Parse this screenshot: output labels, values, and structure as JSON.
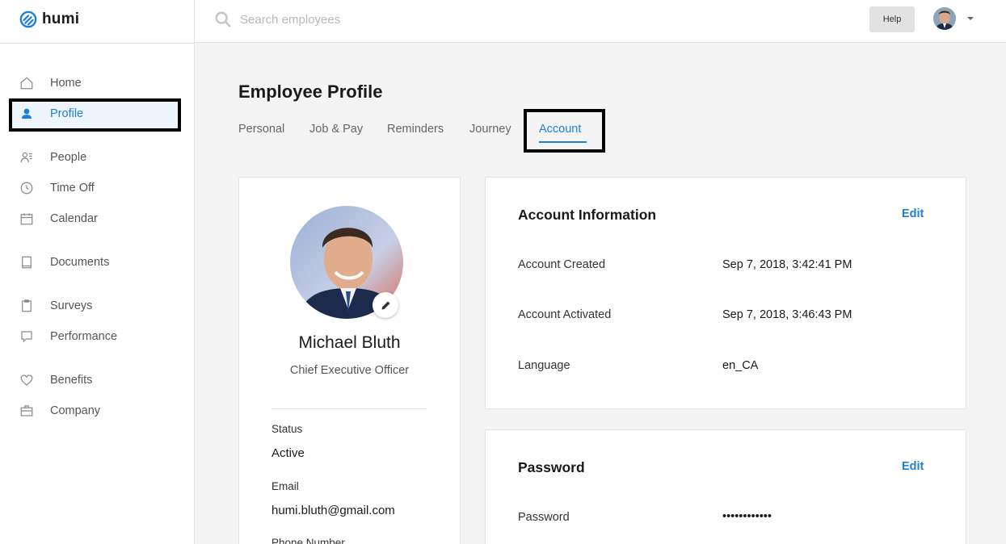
{
  "app": {
    "brand": "humi",
    "accent": "#1b7fe0"
  },
  "sidebar": {
    "items": [
      {
        "label": "Home",
        "icon": "home-icon"
      },
      {
        "label": "Profile",
        "icon": "person-icon",
        "active": true
      },
      {
        "label": "People",
        "icon": "people-icon"
      },
      {
        "label": "Time Off",
        "icon": "clock-icon"
      },
      {
        "label": "Calendar",
        "icon": "calendar-icon"
      },
      {
        "label": "Documents",
        "icon": "document-icon"
      },
      {
        "label": "Surveys",
        "icon": "clipboard-icon"
      },
      {
        "label": "Performance",
        "icon": "chat-icon"
      },
      {
        "label": "Benefits",
        "icon": "heart-icon"
      },
      {
        "label": "Company",
        "icon": "briefcase-icon"
      }
    ]
  },
  "topbar": {
    "search_placeholder": "Search employees",
    "help_label": "Help"
  },
  "page": {
    "title": "Employee Profile",
    "tabs": [
      "Personal",
      "Job & Pay",
      "Reminders",
      "Journey",
      "Account"
    ],
    "active_tab": "Account"
  },
  "profile": {
    "name": "Michael Bluth",
    "job_title": "Chief Executive Officer",
    "status_label": "Status",
    "status_value": "Active",
    "email_label": "Email",
    "email_value": "humi.bluth@gmail.com",
    "phone_label": "Phone Number"
  },
  "account_info": {
    "title": "Account Information",
    "edit_label": "Edit",
    "rows": [
      {
        "label": "Account Created",
        "value": "Sep 7, 2018, 3:42:41 PM"
      },
      {
        "label": "Account Activated",
        "value": "Sep 7, 2018, 3:46:43 PM"
      },
      {
        "label": "Language",
        "value": "en_CA"
      }
    ]
  },
  "password": {
    "title": "Password",
    "edit_label": "Edit",
    "label": "Password",
    "value": "••••••••••••"
  }
}
